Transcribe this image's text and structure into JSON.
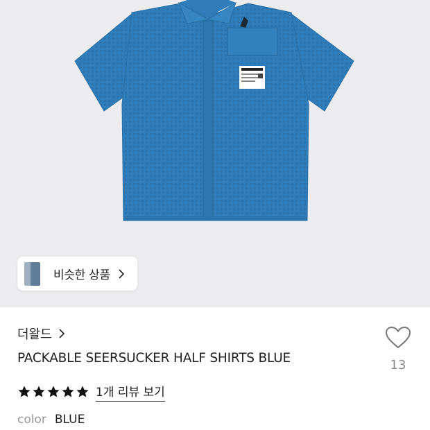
{
  "product_image": {
    "label_text": "THE WORLD",
    "colors": {
      "background": "#ececee",
      "shirt": "#2f7dba",
      "shirt_shadow": "#256a9f"
    }
  },
  "similar_products": {
    "label": "비슷한 상품",
    "icon": "chevron-right-icon"
  },
  "product": {
    "brand": "더왈드",
    "title": "PACKABLE SEERSUCKER HALF SHIRTS BLUE",
    "rating_stars": 5,
    "review_link": "1개 리뷰 보기",
    "color_label": "color",
    "color_value": "BLUE"
  },
  "like": {
    "icon": "heart-outline-icon",
    "count": "13"
  }
}
